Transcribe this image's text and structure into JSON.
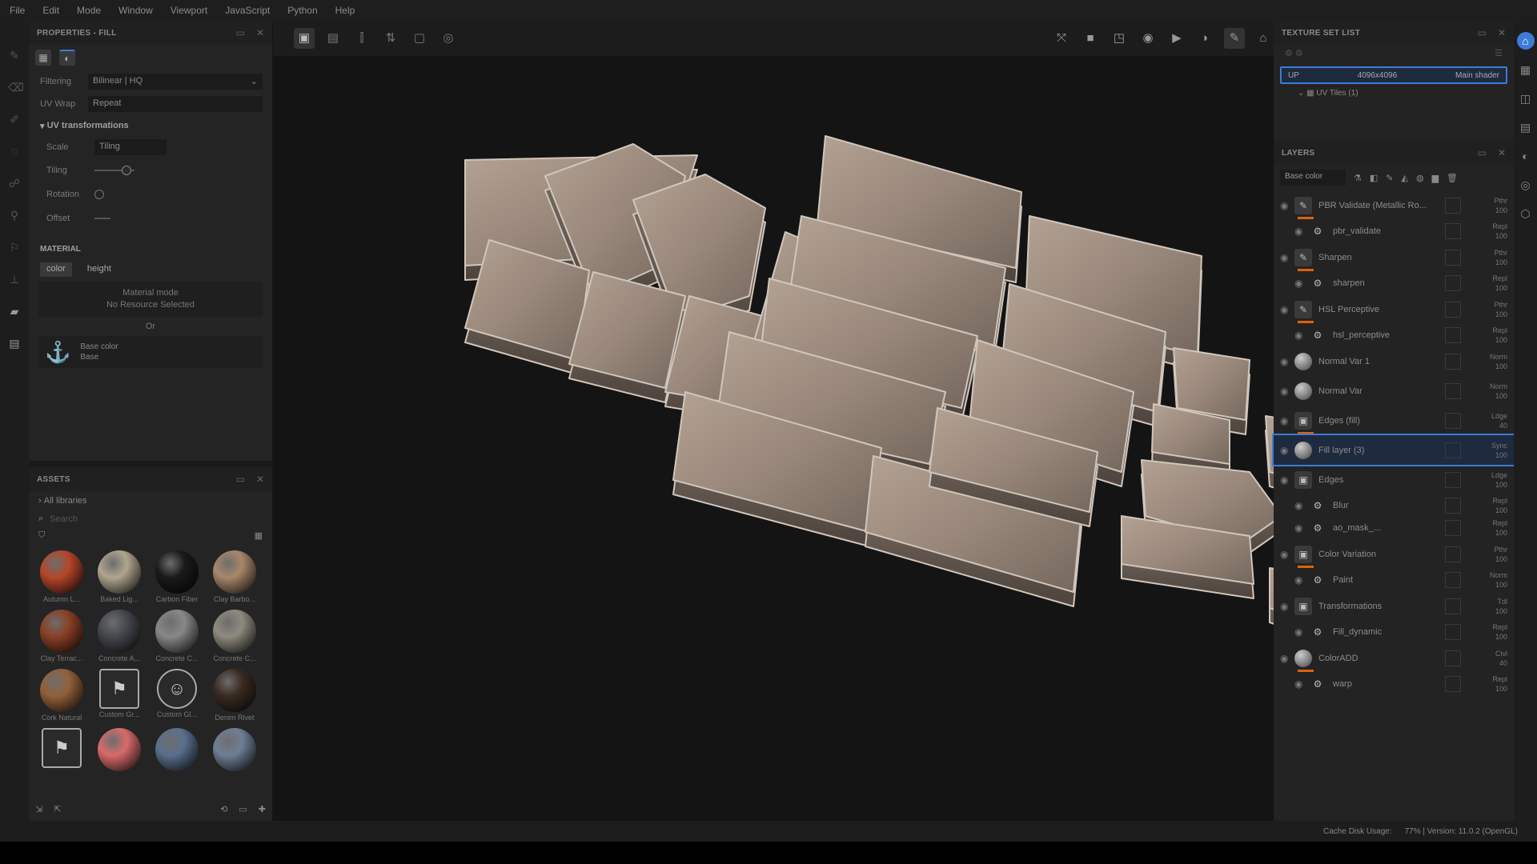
{
  "menu": [
    "File",
    "Edit",
    "Mode",
    "Window",
    "Viewport",
    "JavaScript",
    "Python",
    "Help"
  ],
  "properties": {
    "title": "PROPERTIES - FILL",
    "filtering_label": "Filtering",
    "filtering_value": "Bilinear | HQ",
    "uvwrap_label": "UV Wrap",
    "uvwrap_value": "Repeat",
    "uv_section": "UV transformations",
    "scale_label": "Scale",
    "scale_value": "Tiling",
    "tiling_label": "Tiling",
    "rotation_label": "Rotation",
    "offset_label": "Offset",
    "material_label": "MATERIAL",
    "chip_color": "color",
    "chip_height": "height",
    "material_mode": "Material mode",
    "no_resource": "No Resource Selected",
    "or": "Or",
    "base_color_title": "Base color",
    "base_color_sub": "Base"
  },
  "assets": {
    "title": "ASSETS",
    "library": "All libraries",
    "search_placeholder": "Search",
    "items": [
      {
        "name": "Autumn L...",
        "color": "#b5462a"
      },
      {
        "name": "Baked Lig...",
        "color": "#b0a58f"
      },
      {
        "name": "Carbon Fiber",
        "color": "#1a1a1a"
      },
      {
        "name": "Clay Barbo...",
        "color": "#a8876a"
      },
      {
        "name": "Clay Terrac...",
        "color": "#8a3f26"
      },
      {
        "name": "Concrete A...",
        "color": "#45474d"
      },
      {
        "name": "Concrete C...",
        "color": "#888888"
      },
      {
        "name": "Concrete C...",
        "color": "#8e8a7e"
      },
      {
        "name": "Cork Natural",
        "color": "#93603a"
      },
      {
        "name": "Custom Gr...",
        "color": "icon"
      },
      {
        "name": "Custom Gl...",
        "color": "icon2"
      },
      {
        "name": "Denim Rivet",
        "color": "#3a2b22"
      },
      {
        "name": "",
        "color": "icon3"
      },
      {
        "name": "",
        "color": "#d86b6b"
      },
      {
        "name": "",
        "color": "#5a6f8c"
      },
      {
        "name": "",
        "color": "#6f7f95"
      }
    ]
  },
  "texture_set": {
    "title": "TEXTURE SET LIST",
    "name": "UP",
    "resolution": "4096x4096",
    "shader": "Main shader",
    "uv_tiles": "UV Tiles (1)"
  },
  "layers": {
    "title": "LAYERS",
    "channel": "Base color",
    "items": [
      {
        "name": "PBR Validate (Metallic Ro...",
        "blend": "Pthr",
        "opacity": "100",
        "kind": "brush",
        "orange": true
      },
      {
        "name": "pbr_validate",
        "blend": "Repl",
        "opacity": "100",
        "kind": "sub"
      },
      {
        "name": "Sharpen",
        "blend": "Pthr",
        "opacity": "100",
        "kind": "brush",
        "orange": true
      },
      {
        "name": "sharpen",
        "blend": "Repl",
        "opacity": "100",
        "kind": "sub"
      },
      {
        "name": "HSL Perceptive",
        "blend": "Pthr",
        "opacity": "100",
        "kind": "brush",
        "orange": true
      },
      {
        "name": "hsl_perceptive",
        "blend": "Repl",
        "opacity": "100",
        "kind": "sub"
      },
      {
        "name": "Normal Var 1",
        "blend": "Norm",
        "opacity": "100",
        "kind": "ball"
      },
      {
        "name": "Normal Var",
        "blend": "Norm",
        "opacity": "100",
        "kind": "ball"
      },
      {
        "name": "Edges (fill)",
        "blend": "Ldge",
        "opacity": "40",
        "kind": "folder",
        "orange": true
      },
      {
        "name": "Fill layer (3)",
        "blend": "Sync",
        "opacity": "100",
        "kind": "ball",
        "selected": true
      },
      {
        "name": "Edges",
        "blend": "Ldge",
        "opacity": "100",
        "kind": "folder"
      },
      {
        "name": "Blur",
        "blend": "Repl",
        "opacity": "100",
        "kind": "sub"
      },
      {
        "name": "ao_mask_...",
        "blend": "Repl",
        "opacity": "100",
        "kind": "sub"
      },
      {
        "name": "Color Variation",
        "blend": "Pthr",
        "opacity": "100",
        "kind": "folder",
        "orange": true
      },
      {
        "name": "Paint",
        "blend": "Norm",
        "opacity": "100",
        "kind": "sub"
      },
      {
        "name": "Transformations",
        "blend": "Tdl",
        "opacity": "100",
        "kind": "folder"
      },
      {
        "name": "Fill_dynamic",
        "blend": "Repl",
        "opacity": "100",
        "kind": "sub"
      },
      {
        "name": "ColorADD",
        "blend": "Civl",
        "opacity": "40",
        "kind": "ball",
        "orange": true
      },
      {
        "name": "warp",
        "blend": "Repl",
        "opacity": "100",
        "kind": "sub"
      }
    ]
  },
  "status": {
    "cache": "Cache Disk Usage:",
    "version": "77% | Version: 11.0.2 (OpenGL)"
  },
  "colors": {
    "accent": "#3d7bd9",
    "orange": "#e06010",
    "stone": "#9c8a7c"
  }
}
